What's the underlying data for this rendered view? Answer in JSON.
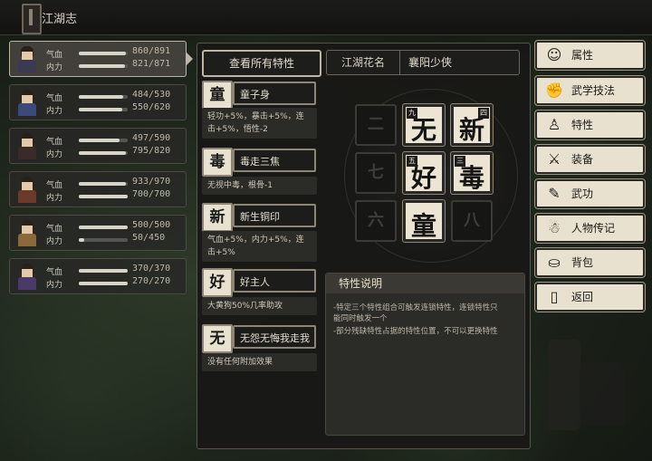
{
  "window": {
    "title": "江湖志"
  },
  "characters": [
    {
      "hp_label": "气血",
      "mp_label": "内力",
      "hp": "860/891",
      "mp": "821/871",
      "hp_pct": 0.965,
      "mp_pct": 0.943,
      "selected": true,
      "robe": "#3b3a52"
    },
    {
      "hp_label": "气血",
      "mp_label": "内力",
      "hp": "484/530",
      "mp": "550/620",
      "hp_pct": 0.913,
      "mp_pct": 0.887,
      "selected": false,
      "robe": "#3a4a7a"
    },
    {
      "hp_label": "气血",
      "mp_label": "内力",
      "hp": "497/590",
      "mp": "795/820",
      "hp_pct": 0.842,
      "mp_pct": 0.97,
      "selected": false,
      "robe": "#3a2a2a"
    },
    {
      "hp_label": "气血",
      "mp_label": "内力",
      "hp": "933/970",
      "mp": "700/700",
      "hp_pct": 0.962,
      "mp_pct": 1.0,
      "selected": false,
      "robe": "#6a3a2a"
    },
    {
      "hp_label": "气血",
      "mp_label": "内力",
      "hp": "500/500",
      "mp": "50/450",
      "hp_pct": 1.0,
      "mp_pct": 0.111,
      "selected": false,
      "robe": "#8a6a3a"
    },
    {
      "hp_label": "气血",
      "mp_label": "内力",
      "hp": "370/370",
      "mp": "270/270",
      "hp_pct": 1.0,
      "mp_pct": 1.0,
      "selected": false,
      "robe": "#4a3a6a"
    }
  ],
  "main": {
    "view_all_label": "查看所有特性",
    "nickname_label": "江湖花名",
    "nickname_value": "襄阳少侠"
  },
  "traits": [
    {
      "icon_char": "童",
      "name": "童子身",
      "desc": "轻功+5%，暴击+5%，连击+5%，悟性-2"
    },
    {
      "icon_char": "毒",
      "name": "毒走三焦",
      "desc": "无视中毒，根骨-1"
    },
    {
      "icon_char": "新",
      "name": "新生铜印",
      "desc": "气血+5%，内力+5%，连击+5%"
    },
    {
      "icon_char": "好",
      "name": "好主人",
      "desc": "大黄狗50%几率助攻"
    },
    {
      "icon_char": "无",
      "name": "无怨无悔我走我路",
      "desc": "没有任何附加效果"
    }
  ],
  "grid": {
    "cells": [
      {
        "num": "二",
        "char": "",
        "tag": "",
        "filled": false
      },
      {
        "num": "",
        "char": "无",
        "tag": "九",
        "filled": true,
        "tag_pos": "tl"
      },
      {
        "num": "",
        "char": "新",
        "tag": "四",
        "filled": true,
        "tag_pos": "tr"
      },
      {
        "num": "七",
        "char": "",
        "tag": "",
        "filled": false
      },
      {
        "num": "",
        "char": "好",
        "tag": "五",
        "filled": true,
        "tag_pos": "tl"
      },
      {
        "num": "",
        "char": "毒",
        "tag": "三",
        "filled": true,
        "tag_pos": "tl"
      },
      {
        "num": "六",
        "char": "",
        "tag": "",
        "filled": false
      },
      {
        "num": "",
        "char": "童",
        "tag": "",
        "filled": true,
        "tag_pos": "tl"
      },
      {
        "num": "八",
        "char": "",
        "tag": "",
        "filled": false
      }
    ]
  },
  "description": {
    "title": "特性说明",
    "lines": [
      "-特定三个特性组合可触发连锁特性，连锁特性只",
      "能同时触发一个",
      "-部分残缺特性占据的特性位置，不可以更换特性"
    ]
  },
  "menu": [
    {
      "icon": "person-icon",
      "glyph": "☺",
      "label": "属性"
    },
    {
      "icon": "martial-skill-icon",
      "glyph": "✊",
      "label": "武学技法"
    },
    {
      "icon": "trait-icon",
      "glyph": "♙",
      "label": "特性"
    },
    {
      "icon": "sword-icon",
      "glyph": "⚔",
      "label": "装备"
    },
    {
      "icon": "scroll-book-icon",
      "glyph": "✎",
      "label": "武功"
    },
    {
      "icon": "biography-icon",
      "glyph": "☃",
      "label": "人物传记"
    },
    {
      "icon": "bag-icon",
      "glyph": "⛀",
      "label": "背包"
    },
    {
      "icon": "exit-door-icon",
      "glyph": "▯",
      "label": "返回"
    }
  ],
  "colors": {
    "panel_bg": "#181816",
    "paper": "#e8e1cf",
    "border_light": "#bdb6a6"
  }
}
